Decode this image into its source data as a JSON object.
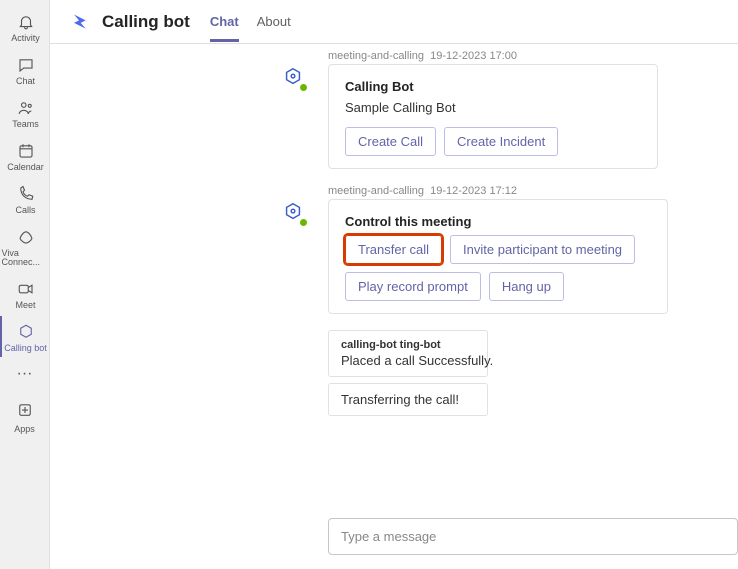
{
  "rail": {
    "items": [
      {
        "label": "Activity",
        "icon": "bell"
      },
      {
        "label": "Chat",
        "icon": "chat"
      },
      {
        "label": "Teams",
        "icon": "teams"
      },
      {
        "label": "Calendar",
        "icon": "calendar"
      },
      {
        "label": "Calls",
        "icon": "calls"
      },
      {
        "label": "Viva Connec...",
        "icon": "viva"
      },
      {
        "label": "Meet",
        "icon": "meet"
      },
      {
        "label": "Calling bot",
        "icon": "bot",
        "selected": true
      }
    ],
    "more": "···",
    "apps_label": "Apps"
  },
  "header": {
    "title": "Calling bot",
    "tabs": [
      {
        "label": "Chat",
        "active": true
      },
      {
        "label": "About",
        "active": false
      }
    ]
  },
  "messages": [
    {
      "sender": "meeting-and-calling",
      "timestamp": "19-12-2023 17:00",
      "card": {
        "title": "Calling Bot",
        "subtitle": "Sample Calling Bot",
        "buttons": [
          "Create Call",
          "Create Incident"
        ]
      }
    },
    {
      "sender": "meeting-and-calling",
      "timestamp": "19-12-2023 17:12",
      "card": {
        "title": "Control this meeting",
        "buttons": [
          "Transfer call",
          "Invite participant to meeting",
          "Play record prompt",
          "Hang up"
        ],
        "highlight_index": 0
      }
    }
  ],
  "plain_messages": [
    {
      "sender": "calling-bot ting-bot",
      "text": "Placed a call Successfully."
    },
    {
      "text": "Transferring the call!"
    }
  ],
  "compose": {
    "placeholder": "Type a message"
  }
}
